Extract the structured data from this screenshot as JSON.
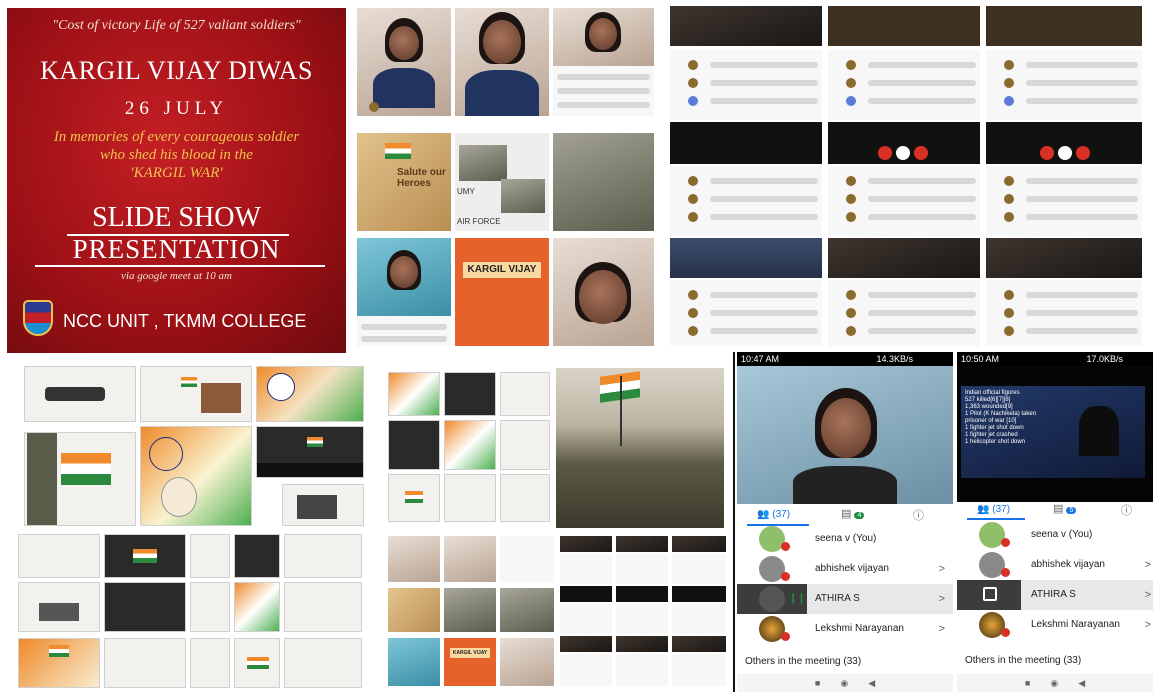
{
  "poster": {
    "quote": "\"Cost of victory Life of 527 valiant soldiers\"",
    "title": "KARGIL VIJAY DIWAS",
    "date": "26 JULY",
    "memory_line1": "In memories of every courageous soldier",
    "memory_line2": "who shed his blood in the",
    "memory_line3": "'KARGIL WAR'",
    "show_line1": "SLIDE SHOW",
    "show_line2": "PRESENTATION",
    "via": "via google meet at 10 am",
    "org": "NCC UNIT , TKMM COLLEGE"
  },
  "slides": {
    "salute": "Salute our Heroes",
    "army_suffix": "UMY",
    "air_force": "AIR FORCE",
    "kargil_vijay": "KARGIL VIJAY",
    "kargil_vijay_small": "KARGIL VIJAY"
  },
  "phone1": {
    "status_time": "10:47 AM",
    "status_net": "14.3KB/s",
    "people_count": "(37)",
    "chat_badge": "4",
    "participants": [
      {
        "name": "seena v (You)",
        "chevron": ""
      },
      {
        "name": "abhishek vijayan",
        "chevron": ">"
      },
      {
        "name": "ATHIRA S",
        "chevron": ">"
      },
      {
        "name": "Lekshmi Narayanan",
        "chevron": ">"
      }
    ],
    "others": "Others in the meeting (33)"
  },
  "phone2": {
    "status_time": "10:50 AM",
    "status_net": "17.0KB/s",
    "people_count": "(37)",
    "chat_badge": "5",
    "participants": [
      {
        "name": "seena v (You)",
        "chevron": ""
      },
      {
        "name": "abhishek vijayan",
        "chevron": ">"
      },
      {
        "name": "ATHIRA S",
        "chevron": ">"
      },
      {
        "name": "Lekshmi Narayanan",
        "chevron": ">"
      }
    ],
    "others": "Others in the meeting (33)",
    "slide_lines": [
      "Indian official figures",
      "527 killed[6][7][8]",
      "1,363 wounded[9]",
      "1 Pilot (K Nachiketa) taken",
      "prisoner of war [10]",
      "1 fighter jet shot down",
      "1 fighter jet crashed",
      "1 helicopter shot down"
    ]
  },
  "colors": {
    "poster_red": "#b5161b",
    "meet_blue": "#1a73e8",
    "mic_red": "#d93025"
  }
}
